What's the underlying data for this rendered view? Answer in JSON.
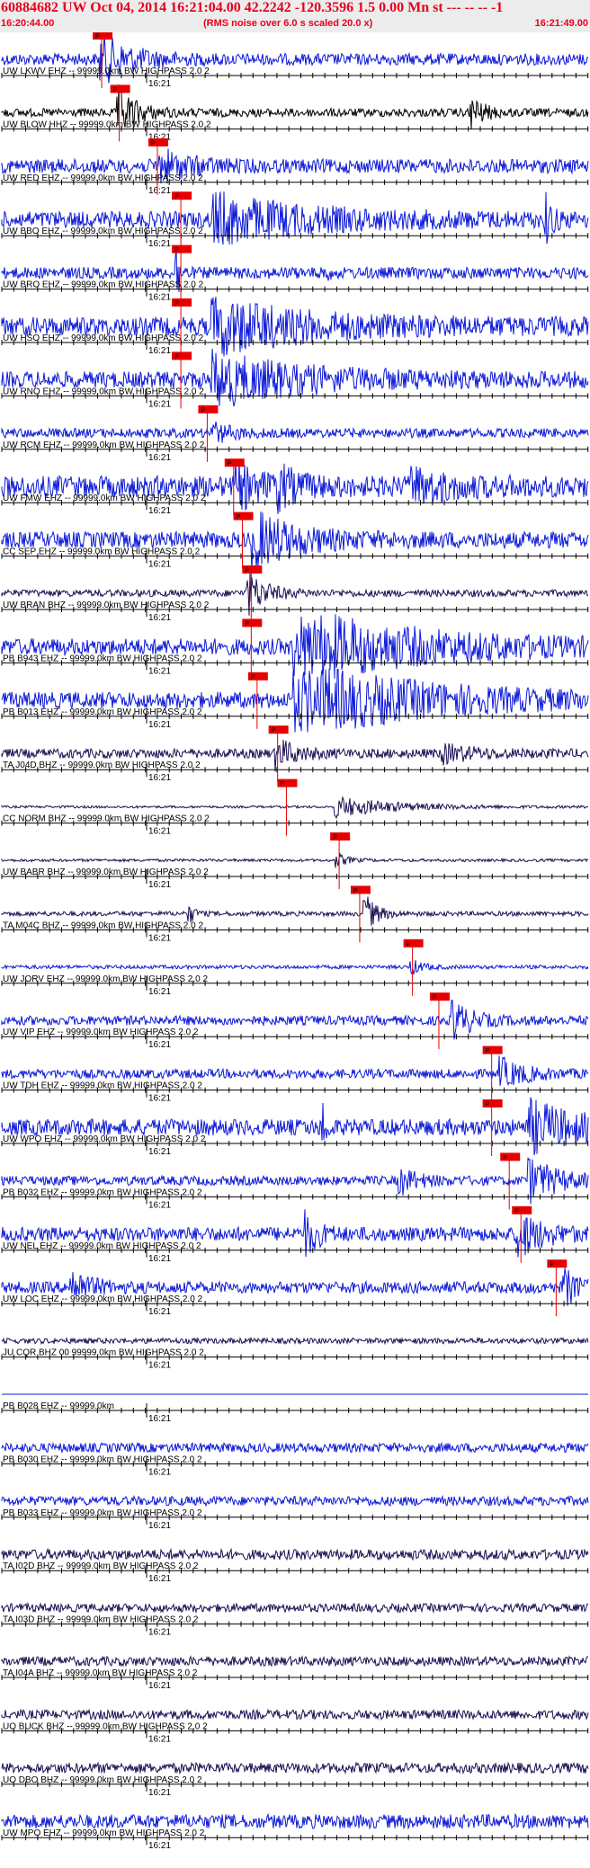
{
  "header": {
    "title": "60884682 UW Oct 04, 2014 16:21:04.00   42.2242 -120.3596  1.5 0.00 Mn st --- -- --  -1",
    "start_time": "16:20:44.00",
    "rms_note": "(RMS noise over 6.0 s scaled 20.0 x)",
    "end_time": "16:21:49.00"
  },
  "colors": {
    "header_text": "#e8001c",
    "header_bg": "#ececec",
    "trace_blue": "#0b18d8",
    "trace_dark": "#1a0f52",
    "trace_black": "#000000",
    "pick": "#e80000",
    "minute_label": "16:21"
  },
  "traces": [
    {
      "label": "UW LKWV EHZ -- 99999.0km BW  HIGHPASS  2.0  2",
      "pick": "P",
      "color": "trace_blue",
      "amp": 0.25,
      "pick_t": 0.155,
      "events": [
        {
          "t": 0.17,
          "a": 1.0,
          "d": 0.05,
          "w": 5
        }
      ]
    },
    {
      "label": "UW BLOW HHZ -- 99999.0km BW  HIGHPASS  2.0  2",
      "pick": "P",
      "color": "trace_black",
      "amp": 0.18,
      "pick_t": 0.185,
      "events": [
        {
          "t": 0.2,
          "a": 1.0,
          "d": 0.03,
          "w": 4
        },
        {
          "t": 0.8,
          "a": 0.7,
          "d": 0.02,
          "w": 3
        }
      ]
    },
    {
      "label": "UW RED EHZ -- 99999.0km BW  HIGHPASS  2.0  2",
      "pick": "P",
      "color": "trace_blue",
      "amp": 0.3,
      "pick_t": 0.25,
      "events": [
        {
          "t": 0.27,
          "a": 0.6,
          "d": 0.05,
          "w": 4
        }
      ]
    },
    {
      "label": "UW BBO EHZ -- 99999.0km BW  HIGHPASS  2.0  2",
      "pick": "P",
      "color": "trace_blue",
      "amp": 0.35,
      "pick_t": 0.29,
      "events": [
        {
          "t": 0.36,
          "a": 1.0,
          "d": 0.15,
          "w": 3
        },
        {
          "t": 0.93,
          "a": 0.9,
          "d": 0.01,
          "w": 4
        }
      ]
    },
    {
      "label": "UW BRO EHZ -- 99999.0km BW  HIGHPASS  2.0  2",
      "pick": "P",
      "color": "trace_blue",
      "amp": 0.25,
      "pick_t": 0.29,
      "events": [
        {
          "t": 0.3,
          "a": 1.2,
          "d": 0.005,
          "w": 4
        },
        {
          "t": 0.55,
          "a": 0.4,
          "d": 0.005,
          "w": 3
        }
      ]
    },
    {
      "label": "UW HSO EHZ -- 99999.0km BW  HIGHPASS  2.0  2",
      "pick": "P",
      "color": "trace_blue",
      "amp": 0.4,
      "pick_t": 0.29,
      "events": [
        {
          "t": 0.36,
          "a": 1.1,
          "d": 0.15,
          "w": 3
        }
      ]
    },
    {
      "label": "UW RNO EHZ -- 99999.0km BW  HIGHPASS  2.0  2",
      "pick": "P",
      "color": "trace_blue",
      "amp": 0.35,
      "pick_t": 0.29,
      "events": [
        {
          "t": 0.36,
          "a": 1.0,
          "d": 0.15,
          "w": 3
        }
      ]
    },
    {
      "label": "UW RCM EHZ -- 99999.0km BW  HIGHPASS  2.0  2",
      "pick": "P",
      "color": "trace_blue",
      "amp": 0.2,
      "pick_t": 0.335,
      "events": [
        {
          "t": 0.36,
          "a": 0.4,
          "d": 0.03,
          "w": 4
        }
      ]
    },
    {
      "label": "UW FMW EHZ -- 99999.0km BW  HIGHPASS  2.0  2",
      "pick": "P",
      "color": "trace_blue",
      "amp": 0.45,
      "pick_t": 0.38,
      "events": [
        {
          "t": 0.4,
          "a": 0.8,
          "d": 0.04,
          "w": 4
        },
        {
          "t": 0.47,
          "a": 0.7,
          "d": 0.03,
          "w": 4
        },
        {
          "t": 0.7,
          "a": 0.6,
          "d": 0.06,
          "w": 4
        }
      ]
    },
    {
      "label": "CC SEP EHZ -- 99999.0km BW  HIGHPASS  2.0  2",
      "pick": "P",
      "color": "trace_blue",
      "amp": 0.35,
      "pick_t": 0.395,
      "events": [
        {
          "t": 0.43,
          "a": 1.1,
          "d": 0.07,
          "w": 4
        }
      ]
    },
    {
      "label": "UW BRAN BHZ -- 99999.0km BW  HIGHPASS  2.0  2",
      "pick": "P",
      "color": "trace_dark",
      "amp": 0.15,
      "pick_t": 0.41,
      "events": [
        {
          "t": 0.42,
          "a": 0.9,
          "d": 0.03,
          "w": 4
        }
      ]
    },
    {
      "label": "PB B943 EHZ -- 99999.0km BW  HIGHPASS  2.0  2",
      "pick": "P",
      "color": "trace_blue",
      "amp": 0.35,
      "pick_t": 0.41,
      "events": [
        {
          "t": 0.5,
          "a": 1.5,
          "d": 0.2,
          "w": 3
        }
      ]
    },
    {
      "label": "PB B013 EHZ -- 99999.0km BW  HIGHPASS  2.0  2",
      "pick": "P",
      "color": "trace_blue",
      "amp": 0.35,
      "pick_t": 0.42,
      "events": [
        {
          "t": 0.5,
          "a": 1.5,
          "d": 0.2,
          "w": 3
        }
      ]
    },
    {
      "label": "TA J04D BHZ -- 99999.0km BW  HIGHPASS  2.0  2",
      "pick": "P",
      "color": "trace_dark",
      "amp": 0.2,
      "pick_t": 0.455,
      "events": [
        {
          "t": 0.47,
          "a": 0.6,
          "d": 0.03,
          "w": 4
        },
        {
          "t": 0.75,
          "a": 0.35,
          "d": 0.05,
          "w": 4
        }
      ]
    },
    {
      "label": "CC NORM BHZ -- 99999.0km BW  HIGHPASS  2.0  2",
      "pick": "P",
      "color": "trace_dark",
      "amp": 0.05,
      "pick_t": 0.47,
      "events": [
        {
          "t": 0.57,
          "a": 0.45,
          "d": 0.1,
          "w": 3
        }
      ]
    },
    {
      "label": "UW BABR BHZ -- 99999.0km BW  HIGHPASS  2.0  2",
      "pick": "P",
      "color": "trace_dark",
      "amp": 0.06,
      "pick_t": 0.56,
      "events": [
        {
          "t": 0.57,
          "a": 0.3,
          "d": 0.02,
          "w": 4
        }
      ]
    },
    {
      "label": "TA M04C BHZ -- 99999.0km BW  HIGHPASS  2.0  2",
      "pick": "P",
      "color": "trace_dark",
      "amp": 0.1,
      "pick_t": 0.595,
      "events": [
        {
          "t": 0.62,
          "a": 0.8,
          "d": 0.02,
          "w": 4
        },
        {
          "t": 0.32,
          "a": 0.4,
          "d": 0.01,
          "w": 4
        }
      ]
    },
    {
      "label": "UW JORV EHZ -- 99999.0km BW  HIGHPASS  2.0  2",
      "pick": "P",
      "color": "trace_blue",
      "amp": 0.08,
      "pick_t": 0.685,
      "events": [
        {
          "t": 0.7,
          "a": 0.3,
          "d": 0.02,
          "w": 4
        }
      ]
    },
    {
      "label": "UW VIP EHZ -- 99999.0km BW  HIGHPASS  2.0  2",
      "pick": "P",
      "color": "trace_blue",
      "amp": 0.2,
      "pick_t": 0.73,
      "events": [
        {
          "t": 0.77,
          "a": 0.8,
          "d": 0.03,
          "w": 4
        }
      ]
    },
    {
      "label": "UW TDH EHZ -- 99999.0km BW  HIGHPASS  2.0  2",
      "pick": "P",
      "color": "trace_blue",
      "amp": 0.2,
      "pick_t": 0.82,
      "events": [
        {
          "t": 0.85,
          "a": 0.6,
          "d": 0.04,
          "w": 4
        }
      ]
    },
    {
      "label": "UW WPO EHZ -- 99999.0km BW  HIGHPASS  2.0  2",
      "pick": "P",
      "color": "trace_blue",
      "amp": 0.35,
      "pick_t": 0.82,
      "events": [
        {
          "t": 0.55,
          "a": 1.0,
          "d": 0.004,
          "w": 4
        },
        {
          "t": 0.9,
          "a": 1.0,
          "d": 0.08,
          "w": 3
        }
      ]
    },
    {
      "label": "PB B032 EHZ -- 99999.0km BW  HIGHPASS  2.0  2",
      "pick": "P",
      "color": "trace_blue",
      "amp": 0.2,
      "pick_t": 0.85,
      "events": [
        {
          "t": 0.68,
          "a": 0.5,
          "d": 0.03,
          "w": 4
        },
        {
          "t": 0.9,
          "a": 0.9,
          "d": 0.05,
          "w": 4
        }
      ]
    },
    {
      "label": "UW NEL EHZ -- 99999.0km BW  HIGHPASS  2.0  2",
      "pick": "P",
      "color": "trace_blue",
      "amp": 0.3,
      "pick_t": 0.87,
      "events": [
        {
          "t": 0.52,
          "a": 0.8,
          "d": 0.02,
          "w": 4
        },
        {
          "t": 0.88,
          "a": 0.9,
          "d": 0.04,
          "w": 4
        }
      ]
    },
    {
      "label": "UW LOC EHZ -- 99999.0km BW  HIGHPASS  2.0  2",
      "pick": "P",
      "color": "trace_blue",
      "amp": 0.25,
      "pick_t": 0.93,
      "events": [
        {
          "t": 0.12,
          "a": 0.7,
          "d": 0.03,
          "w": 4
        },
        {
          "t": 0.96,
          "a": 0.8,
          "d": 0.02,
          "w": 4
        }
      ]
    },
    {
      "label": "JU CQR BHZ 00 99999.0km BW  HIGHPASS  2.0  2",
      "pick": "",
      "color": "trace_dark",
      "amp": 0.12,
      "pick_t": -1,
      "events": []
    },
    {
      "label": "PB B028 EHZ -- 99999.0km",
      "pick": "",
      "color": "trace_blue",
      "amp": 0.0,
      "pick_t": -1,
      "events": []
    },
    {
      "label": "PB B030 EHZ -- 99999.0km BW  HIGHPASS  2.0  2",
      "pick": "",
      "color": "trace_blue",
      "amp": 0.2,
      "pick_t": -1,
      "events": []
    },
    {
      "label": "PB B033 EHZ -- 99999.0km BW  HIGHPASS  2.0  2",
      "pick": "",
      "color": "trace_blue",
      "amp": 0.2,
      "pick_t": -1,
      "events": []
    },
    {
      "label": "TA I02D BHZ -- 99999.0km BW  HIGHPASS  2.0  2",
      "pick": "",
      "color": "trace_dark",
      "amp": 0.22,
      "pick_t": -1,
      "events": []
    },
    {
      "label": "TA I03D BHZ -- 99999.0km BW  HIGHPASS  2.0  2",
      "pick": "",
      "color": "trace_dark",
      "amp": 0.18,
      "pick_t": -1,
      "events": []
    },
    {
      "label": "TA I04A BHZ -- 99999.0km BW  HIGHPASS  2.0  2",
      "pick": "",
      "color": "trace_dark",
      "amp": 0.2,
      "pick_t": -1,
      "events": []
    },
    {
      "label": "UO BUCK BHZ -- 99999.0km BW  HIGHPASS  2.0  2",
      "pick": "",
      "color": "trace_dark",
      "amp": 0.2,
      "pick_t": -1,
      "events": []
    },
    {
      "label": "UO DBO BHZ -- 99999.0km BW  HIGHPASS  2.0  2",
      "pick": "",
      "color": "trace_dark",
      "amp": 0.22,
      "pick_t": -1,
      "events": []
    },
    {
      "label": "UW MPO EHZ -- 99999.0km BW  HIGHPASS  2.0  2",
      "pick": "",
      "color": "trace_blue",
      "amp": 0.3,
      "pick_t": -1,
      "events": []
    }
  ]
}
